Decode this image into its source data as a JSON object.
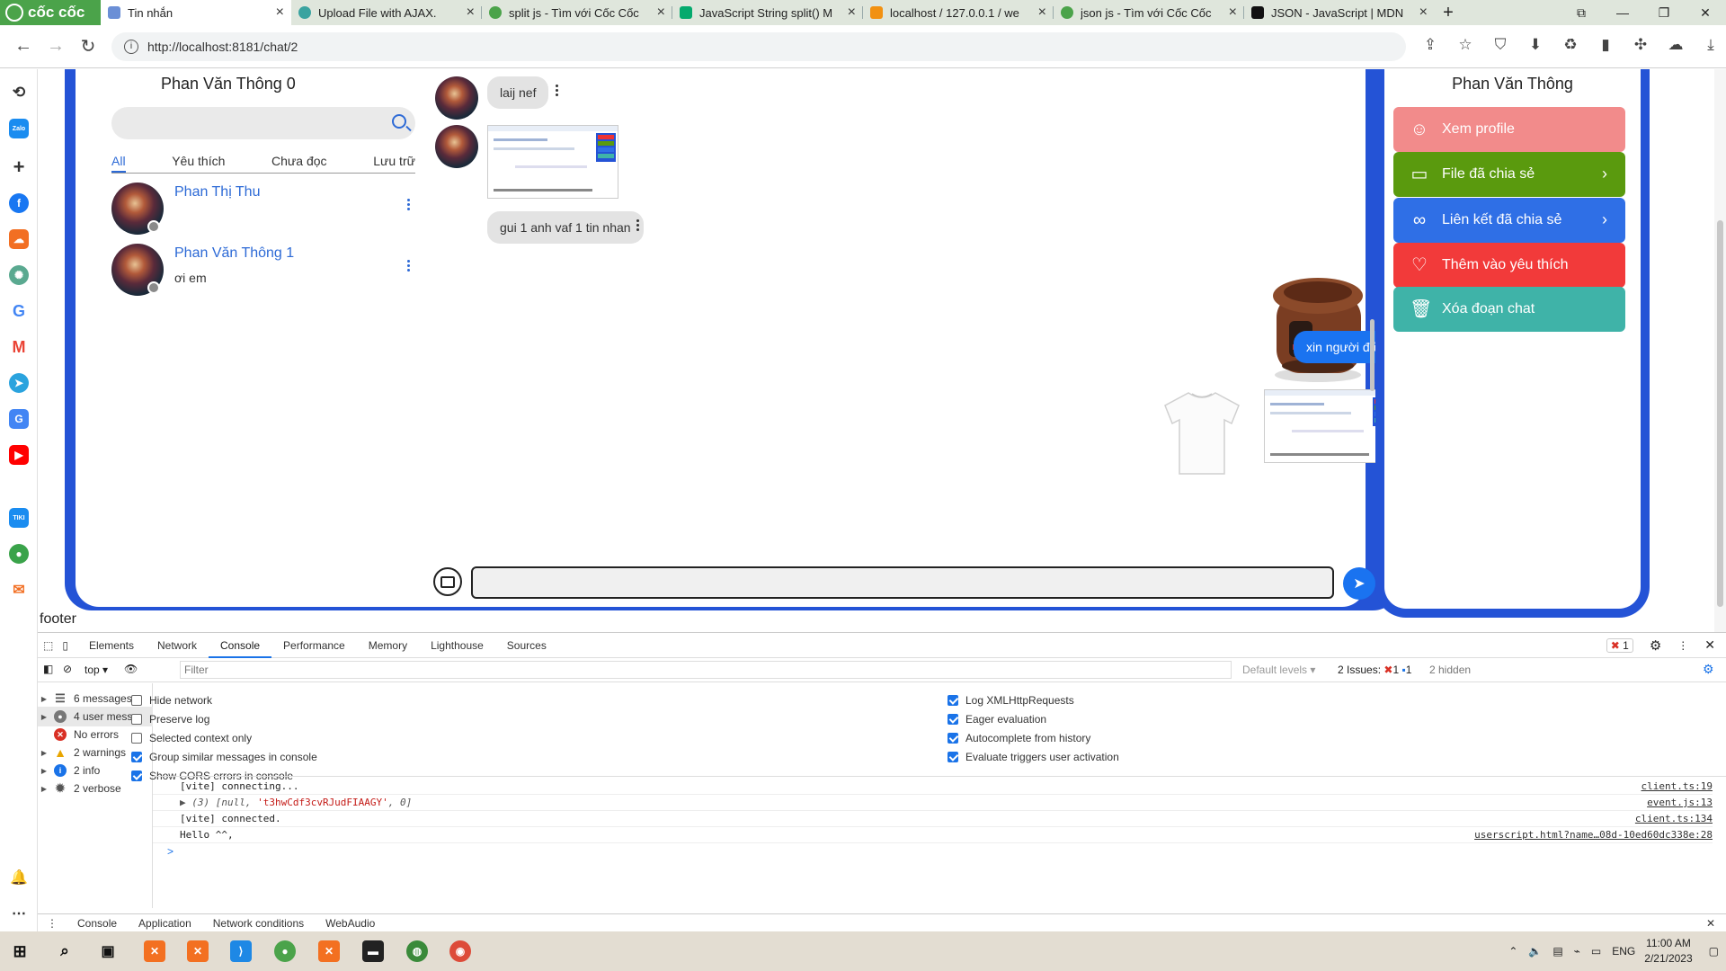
{
  "browser": {
    "brand": "cốc cốc",
    "tabs": [
      {
        "title": "Tin nhắn",
        "active": true
      },
      {
        "title": "Upload File with AJAX.",
        "active": false
      },
      {
        "title": "split js - Tìm với Cốc Cốc",
        "active": false
      },
      {
        "title": "JavaScript String split() M",
        "active": false
      },
      {
        "title": "localhost / 127.0.0.1 / we",
        "active": false
      },
      {
        "title": "json js - Tìm với Cốc Cốc",
        "active": false
      },
      {
        "title": "JSON - JavaScript | MDN",
        "active": false
      }
    ],
    "url": "http://localhost:8181/chat/2"
  },
  "sidebar_icons": [
    "history-icon",
    "zalo-icon",
    "plus-icon",
    "facebook-icon",
    "soundcloud-icon",
    "chatgpt-icon",
    "google-icon",
    "gmail-icon",
    "telegram-icon",
    "google-translate-icon",
    "youtube-icon",
    "tiki-icon",
    "coccoc-game-icon",
    "lazada-icon"
  ],
  "conversation_list": {
    "owner_name": "Phan Văn Thông 0",
    "search_placeholder": "",
    "filter_tabs": [
      "All",
      "Yêu thích",
      "Chưa đọc",
      "Lưu trữ"
    ],
    "active_filter": "All",
    "conversations": [
      {
        "name": "Phan Thị Thu",
        "last_message": ""
      },
      {
        "name": "Phan Văn Thông 1",
        "last_message": "ơi em"
      }
    ]
  },
  "messages": [
    {
      "from": "other",
      "type": "text",
      "text": "laij nef"
    },
    {
      "from": "other",
      "type": "image",
      "alt": "screenshot thumbnail"
    },
    {
      "from": "other",
      "type": "text",
      "text": "gui 1 anh vaf 1 tin nhan"
    },
    {
      "from": "me",
      "type": "image",
      "alt": "rice cooker photo"
    },
    {
      "from": "me",
      "type": "text",
      "text": "xin người đấy"
    },
    {
      "from": "me",
      "type": "image",
      "alt": "white t-shirt photo"
    },
    {
      "from": "me",
      "type": "image",
      "alt": "screenshot thumbnail"
    }
  ],
  "composer": {
    "value": "",
    "placeholder": ""
  },
  "right_panel": {
    "title": "Phan Văn Thông",
    "buttons": [
      {
        "label": "Xem profile",
        "color": "#f28b8b",
        "icon": "profile-icon",
        "chevron": false
      },
      {
        "label": "File đã chia sẻ",
        "color": "#5a9a0e",
        "icon": "file-icon",
        "chevron": true
      },
      {
        "label": "Liên kết đã chia sẻ",
        "color": "#2f6fe6",
        "icon": "link-icon",
        "chevron": true
      },
      {
        "label": "Thêm vào yêu thích",
        "color": "#f23a3a",
        "icon": "heart-icon",
        "chevron": false
      },
      {
        "label": "Xóa đoạn chat",
        "color": "#3fb3a8",
        "icon": "trash-icon",
        "chevron": false
      }
    ]
  },
  "footer_text": "footer",
  "devtools": {
    "tabs": [
      "Elements",
      "Network",
      "Console",
      "Performance",
      "Memory",
      "Lighthouse",
      "Sources"
    ],
    "active_tab": "Console",
    "error_badge": "1",
    "context": "top",
    "filter_placeholder": "Filter",
    "levels": "Default levels",
    "issues_label": "2 Issues:",
    "issues_errors": "1",
    "issues_info": "1",
    "hidden": "2 hidden",
    "sidebar": [
      {
        "label": "6 messages",
        "icon": "list-icon"
      },
      {
        "label": "4 user mess...",
        "icon": "user-icon"
      },
      {
        "label": "No errors",
        "icon": "error-icon"
      },
      {
        "label": "2 warnings",
        "icon": "warning-icon"
      },
      {
        "label": "2 info",
        "icon": "info-icon"
      },
      {
        "label": "2 verbose",
        "icon": "verbose-icon"
      }
    ],
    "options_left": [
      {
        "label": "Hide network",
        "checked": false
      },
      {
        "label": "Preserve log",
        "checked": false
      },
      {
        "label": "Selected context only",
        "checked": false
      },
      {
        "label": "Group similar messages in console",
        "checked": true
      },
      {
        "label": "Show CORS errors in console",
        "checked": true
      }
    ],
    "options_right": [
      {
        "label": "Log XMLHttpRequests",
        "checked": true
      },
      {
        "label": "Eager evaluation",
        "checked": true
      },
      {
        "label": "Autocomplete from history",
        "checked": true
      },
      {
        "label": "Evaluate triggers user activation",
        "checked": true
      }
    ],
    "console_lines": [
      {
        "text": "[vite] connecting...",
        "source": "client.ts:19"
      },
      {
        "prefix": "▶ (3) [null, ",
        "string": "'t3hwCdf3cvRJudFIAAGY'",
        "suffix": ", 0]",
        "source": "event.js:13"
      },
      {
        "text": "[vite] connected.",
        "source": "client.ts:134"
      },
      {
        "text": "Hello ^^,",
        "source": "userscript.html?name…08d-10ed60dc338e:28"
      }
    ],
    "prompt": ">",
    "drawer_tabs": [
      "Console",
      "Application",
      "Network conditions",
      "WebAudio"
    ],
    "drawer_active": "Application"
  },
  "taskbar": {
    "language": "ENG",
    "time": "11:00 AM",
    "date": "2/21/2023"
  }
}
